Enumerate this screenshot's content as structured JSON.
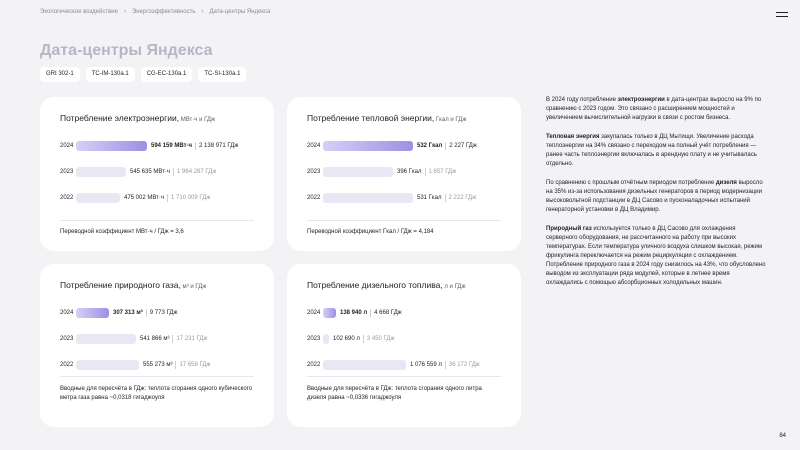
{
  "breadcrumb": [
    "Экологическое воздействие",
    "Энергоэффективность",
    "Дата-центры Яндекса"
  ],
  "page_title": "Дата-центры Яндекса",
  "tags": [
    "GRI 302-1",
    "TC-IM-130a.1",
    "CG-EC-130a.1",
    "TC-SI-130a.1"
  ],
  "cards": [
    {
      "title": "Потребление электроэнергии,",
      "unit": " МВт·ч и ГДж",
      "rows": [
        {
          "year": "2024",
          "value": "594 159 МВт·ч",
          "gj": "2 138 971 ГДж",
          "fraction": 0.6,
          "highlight": true
        },
        {
          "year": "2023",
          "value": "545 635 МВт·ч",
          "gj": "1 964 287 ГДж",
          "fraction": 0.42,
          "highlight": false
        },
        {
          "year": "2022",
          "value": "475 002 МВт·ч",
          "gj": "1 710 009 ГДж",
          "fraction": 0.37,
          "highlight": false
        }
      ],
      "note": "Переводной коэффициент МВт·ч / ГДж = 3,6"
    },
    {
      "title": "Потребление тепловой энергии,",
      "unit": " Гкал и ГДж",
      "rows": [
        {
          "year": "2024",
          "value": "532 Гкал",
          "gj": "2 227 ГДж",
          "fraction": 0.76,
          "highlight": true
        },
        {
          "year": "2023",
          "value": "396 Гкал",
          "gj": "1 657 ГДж",
          "fraction": 0.59,
          "highlight": false
        },
        {
          "year": "2022",
          "value": "531 Гкал",
          "gj": "2 222 ГДж",
          "fraction": 0.76,
          "highlight": false
        }
      ],
      "note": "Переводной коэффициент Гкал / ГДж = 4,184"
    },
    {
      "title": "Потребление природного газа,",
      "unit": " м³ и ГДж",
      "rows": [
        {
          "year": "2024",
          "value": "307 313 м³",
          "gj": "9 773 ГДж",
          "fraction": 0.28,
          "highlight": true
        },
        {
          "year": "2023",
          "value": "541 866 м³",
          "gj": "17 231 ГДж",
          "fraction": 0.51,
          "highlight": false
        },
        {
          "year": "2022",
          "value": "555 273 м³",
          "gj": "17 658 ГДж",
          "fraction": 0.53,
          "highlight": false
        }
      ],
      "note": "Вводные для пересчёта в ГДж: теплота сгорания одного кубического метра газа равна ~0,0318 гигаджоуля"
    },
    {
      "title": "Потребление дизельного топлива,",
      "unit": " л и ГДж",
      "rows": [
        {
          "year": "2024",
          "value": "138 940 л",
          "gj": "4 668 ГДж",
          "fraction": 0.11,
          "highlight": true
        },
        {
          "year": "2023",
          "value": "102 690 л",
          "gj": "3 450 ГДж",
          "fraction": 0.05,
          "highlight": false
        },
        {
          "year": "2022",
          "value": "1 076 559 л",
          "gj": "36 172 ГДж",
          "fraction": 0.7,
          "highlight": false
        }
      ],
      "note": "Вводные для пересчёта в ГДж: теплота сгорания одного литра дизеля равна ~0,0336 гигаджоуля"
    }
  ],
  "paragraphs": [
    {
      "pre": "В 2024 году потребление ",
      "bold": "электроэнергии",
      "post": " в дата-центрах выросло на 9% по сравнению с 2023 годом. Это связано с расширением мощностей и увеличением вычислительной нагрузки в связи с ростом бизнеса."
    },
    {
      "pre": "",
      "bold": "Тепловая энергия",
      "post": " закупалась только в ДЦ Мытищи. Увеличение расхода теплоэнергии на 34% связано с переходом на полный учёт потребления — ранее часть теплоэнергии включалась в арендную плату и не учитывалась отдельно."
    },
    {
      "pre": "По сравнению с прошлым отчётным периодом потребление ",
      "bold": "дизеля",
      "post": " выросло на 35% из-за использования дизельных генераторов в период модернизации высоковольтной подстанции в ДЦ Сасово и пусконаладочных испытаний генераторной установки в ДЦ Владимир."
    },
    {
      "pre": "",
      "bold": "Природный газ",
      "post": " используется только в ДЦ Сасово для охлаждения серверного оборудования, не рассчитанного на работу при высоких температурах. Если температура уличного воздуха слишком высокая, режим фрикулинга переключается на режим рециркуляции с охлаждением. Потребление природного газа в 2024 году снизилось на 43%, что обусловлено выводом из эксплуатации ряда модулей, которые в летнее время охлаждались с помощью абсорбционных холодильных машин."
    }
  ],
  "page_number": "84",
  "colors": {
    "accent_bar": "#9e8fe4",
    "muted_bar": "#e8e7f3",
    "title_muted": "#b7b6c6"
  }
}
